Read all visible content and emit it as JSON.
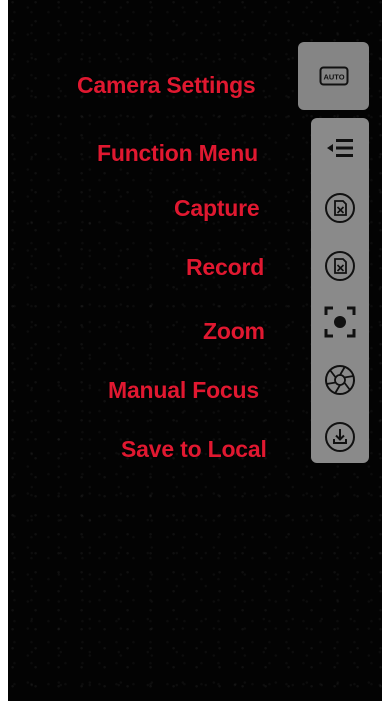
{
  "labels": {
    "camera_settings": "Camera Settings",
    "function_menu": "Function Menu",
    "capture": "Capture",
    "record": "Record",
    "zoom": "Zoom",
    "manual_focus": "Manual Focus",
    "save_to_local": "Save to Local"
  },
  "camera_mode_badge": "AUTO",
  "icons": {
    "camera_settings": "auto-mode-icon",
    "function_menu": "menu-icon",
    "capture": "capture-icon",
    "record": "record-icon",
    "zoom": "zoom-icon",
    "manual_focus": "aperture-icon",
    "save_to_local": "download-icon"
  },
  "colors": {
    "label_text": "#e01830",
    "background": "#030303",
    "panel": "#8a8a8a",
    "icon": "#111111"
  }
}
